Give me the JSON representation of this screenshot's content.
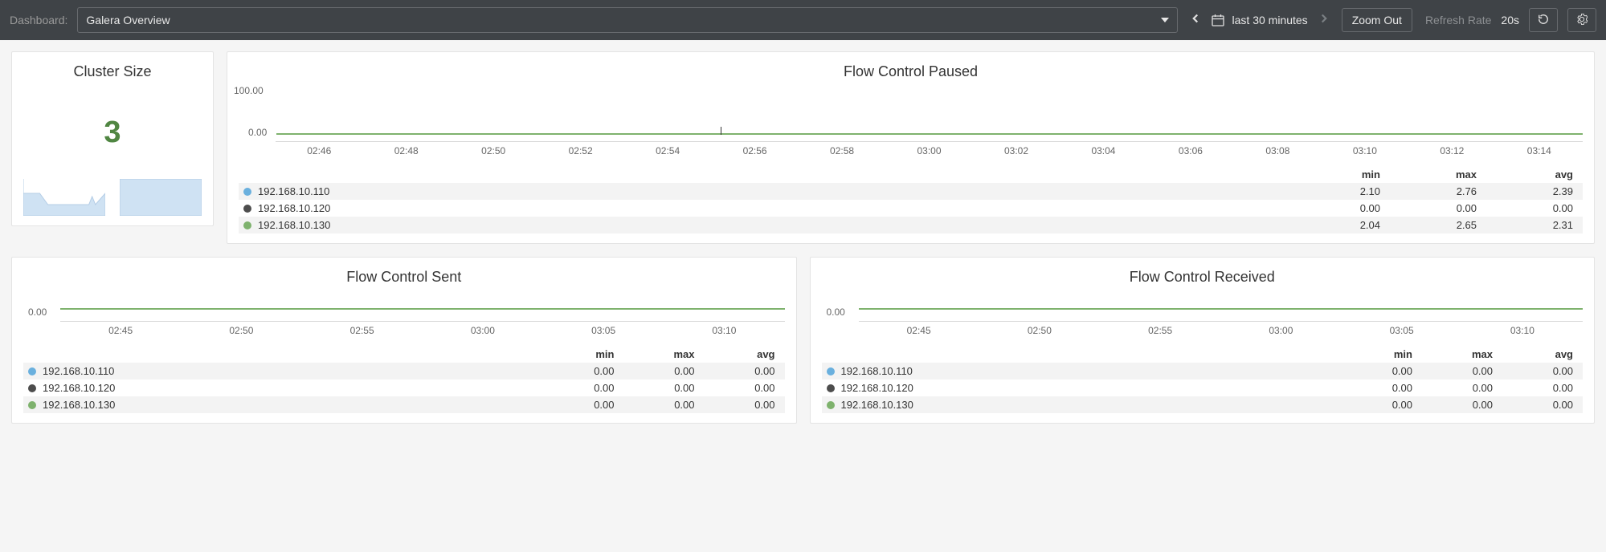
{
  "topbar": {
    "label": "Dashboard:",
    "selected": "Galera Overview",
    "time_range": "last 30 minutes",
    "zoom_out": "Zoom Out",
    "refresh_label": "Refresh Rate",
    "refresh_value": "20s"
  },
  "panels": {
    "cluster_size": {
      "title": "Cluster Size",
      "value": "3"
    },
    "flow_paused": {
      "title": "Flow Control Paused",
      "ymax": "100.00",
      "ymin": "0.00",
      "xticks": [
        "02:46",
        "02:48",
        "02:50",
        "02:52",
        "02:54",
        "02:56",
        "02:58",
        "03:00",
        "03:02",
        "03:04",
        "03:06",
        "03:08",
        "03:10",
        "03:12",
        "03:14"
      ],
      "headers": {
        "min": "min",
        "max": "max",
        "avg": "avg"
      },
      "series": [
        {
          "name": "192.168.10.110",
          "color": "#6ab0de",
          "min": "2.10",
          "max": "2.76",
          "avg": "2.39"
        },
        {
          "name": "192.168.10.120",
          "color": "#4d4d4d",
          "min": "0.00",
          "max": "0.00",
          "avg": "0.00"
        },
        {
          "name": "192.168.10.130",
          "color": "#7eb26d",
          "min": "2.04",
          "max": "2.65",
          "avg": "2.31"
        }
      ]
    },
    "flow_sent": {
      "title": "Flow Control Sent",
      "ymin": "0.00",
      "xticks": [
        "02:45",
        "02:50",
        "02:55",
        "03:00",
        "03:05",
        "03:10"
      ],
      "headers": {
        "min": "min",
        "max": "max",
        "avg": "avg"
      },
      "series": [
        {
          "name": "192.168.10.110",
          "color": "#6ab0de",
          "min": "0.00",
          "max": "0.00",
          "avg": "0.00"
        },
        {
          "name": "192.168.10.120",
          "color": "#4d4d4d",
          "min": "0.00",
          "max": "0.00",
          "avg": "0.00"
        },
        {
          "name": "192.168.10.130",
          "color": "#7eb26d",
          "min": "0.00",
          "max": "0.00",
          "avg": "0.00"
        }
      ]
    },
    "flow_recv": {
      "title": "Flow Control Received",
      "ymin": "0.00",
      "xticks": [
        "02:45",
        "02:50",
        "02:55",
        "03:00",
        "03:05",
        "03:10"
      ],
      "headers": {
        "min": "min",
        "max": "max",
        "avg": "avg"
      },
      "series": [
        {
          "name": "192.168.10.110",
          "color": "#6ab0de",
          "min": "0.00",
          "max": "0.00",
          "avg": "0.00"
        },
        {
          "name": "192.168.10.120",
          "color": "#4d4d4d",
          "min": "0.00",
          "max": "0.00",
          "avg": "0.00"
        },
        {
          "name": "192.168.10.130",
          "color": "#7eb26d",
          "min": "0.00",
          "max": "0.00",
          "avg": "0.00"
        }
      ]
    }
  },
  "chart_data": [
    {
      "type": "line",
      "title": "Flow Control Paused",
      "xlabel": "",
      "ylabel": "",
      "ylim": [
        0,
        100
      ],
      "x": [
        "02:46",
        "02:48",
        "02:50",
        "02:52",
        "02:54",
        "02:56",
        "02:58",
        "03:00",
        "03:02",
        "03:04",
        "03:06",
        "03:08",
        "03:10",
        "03:12",
        "03:14"
      ],
      "series": [
        {
          "name": "192.168.10.110",
          "values": [
            2.4,
            2.4,
            2.4,
            2.4,
            2.4,
            2.4,
            2.4,
            2.4,
            2.4,
            2.4,
            2.4,
            2.4,
            2.4,
            2.4,
            2.4
          ]
        },
        {
          "name": "192.168.10.120",
          "values": [
            0,
            0,
            0,
            0,
            0,
            0,
            0,
            0,
            0,
            0,
            0,
            0,
            0,
            0,
            0
          ]
        },
        {
          "name": "192.168.10.130",
          "values": [
            2.3,
            2.3,
            2.3,
            2.3,
            2.3,
            2.3,
            2.3,
            2.3,
            2.3,
            2.3,
            2.3,
            2.3,
            2.3,
            2.3,
            2.3
          ]
        }
      ]
    },
    {
      "type": "line",
      "title": "Flow Control Sent",
      "xlabel": "",
      "ylabel": "",
      "ylim": [
        0,
        0
      ],
      "x": [
        "02:45",
        "02:50",
        "02:55",
        "03:00",
        "03:05",
        "03:10"
      ],
      "series": [
        {
          "name": "192.168.10.110",
          "values": [
            0,
            0,
            0,
            0,
            0,
            0
          ]
        },
        {
          "name": "192.168.10.120",
          "values": [
            0,
            0,
            0,
            0,
            0,
            0
          ]
        },
        {
          "name": "192.168.10.130",
          "values": [
            0,
            0,
            0,
            0,
            0,
            0
          ]
        }
      ]
    },
    {
      "type": "line",
      "title": "Flow Control Received",
      "xlabel": "",
      "ylabel": "",
      "ylim": [
        0,
        0
      ],
      "x": [
        "02:45",
        "02:50",
        "02:55",
        "03:00",
        "03:05",
        "03:10"
      ],
      "series": [
        {
          "name": "192.168.10.110",
          "values": [
            0,
            0,
            0,
            0,
            0,
            0
          ]
        },
        {
          "name": "192.168.10.120",
          "values": [
            0,
            0,
            0,
            0,
            0,
            0
          ]
        },
        {
          "name": "192.168.10.130",
          "values": [
            0,
            0,
            0,
            0,
            0,
            0
          ]
        }
      ]
    }
  ]
}
